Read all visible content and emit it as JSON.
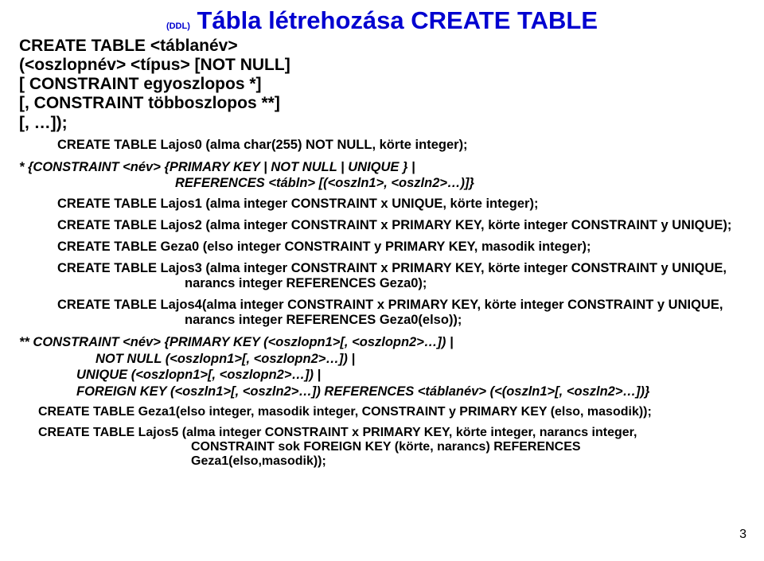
{
  "title": {
    "ddl": "(DDL)",
    "main": " Tábla létrehozása CREATE TABLE"
  },
  "syntax1": {
    "l1": "CREATE TABLE  <táblanév>",
    "l2": "(<oszlopnév> <típus> [NOT NULL]",
    "l3": "[ CONSTRAINT egyoszlopos *]",
    "l4": "[, CONSTRAINT többoszlopos **]",
    "l5": "[, …]);"
  },
  "code1": "CREATE TABLE Lajos0 (alma char(255) NOT NULL, körte integer);",
  "syntax2": {
    "l1": "* {CONSTRAINT <név> {PRIMARY KEY | NOT NULL | UNIQUE } |",
    "l2": "REFERENCES <tábln> [(<oszln1>, <oszln2>…)]}"
  },
  "codes": {
    "lajos1": "CREATE TABLE Lajos1 (alma integer CONSTRAINT x   UNIQUE, körte integer);",
    "lajos2": "CREATE TABLE Lajos2 (alma integer CONSTRAINT x PRIMARY KEY, körte integer CONSTRAINT y   UNIQUE);",
    "geza0": "CREATE TABLE Geza0 (elso integer CONSTRAINT y PRIMARY KEY, masodik integer);",
    "lajos3a": "CREATE TABLE Lajos3 (alma integer CONSTRAINT x PRIMARY KEY, körte integer CONSTRAINT y   UNIQUE,",
    "lajos3b": "narancs integer REFERENCES Geza0);",
    "lajos4a": "CREATE TABLE Lajos4(alma integer CONSTRAINT x PRIMARY KEY, körte integer CONSTRAINT y   UNIQUE,",
    "lajos4b": "narancs integer REFERENCES Geza0(elso));"
  },
  "syntax3": {
    "l1": "** CONSTRAINT <név> {PRIMARY KEY  (<oszlopn1>[, <oszlopn2>…]) |",
    "l2": "NOT NULL  (<oszlopn1>[, <oszlopn2>…]) |",
    "l3": "UNIQUE (<oszlopn1>[, <oszlopn2>…]) |",
    "l4": "FOREIGN KEY   (<oszln1>[, <oszln2>…]) REFERENCES <táblanév> (<(oszln1>[, <oszln2>…])}"
  },
  "codes2": {
    "geza1": "CREATE TABLE Geza1(elso  integer, masodik integer,  CONSTRAINT y PRIMARY KEY (elso, masodik));",
    "lajos5a": "CREATE TABLE Lajos5 (alma integer CONSTRAINT x PRIMARY KEY,  körte integer, narancs integer,",
    "lajos5b": "CONSTRAINT sok FOREIGN KEY  (körte, narancs)  REFERENCES",
    "lajos5c": "Geza1(elso,masodik));"
  },
  "pagenum": "3"
}
